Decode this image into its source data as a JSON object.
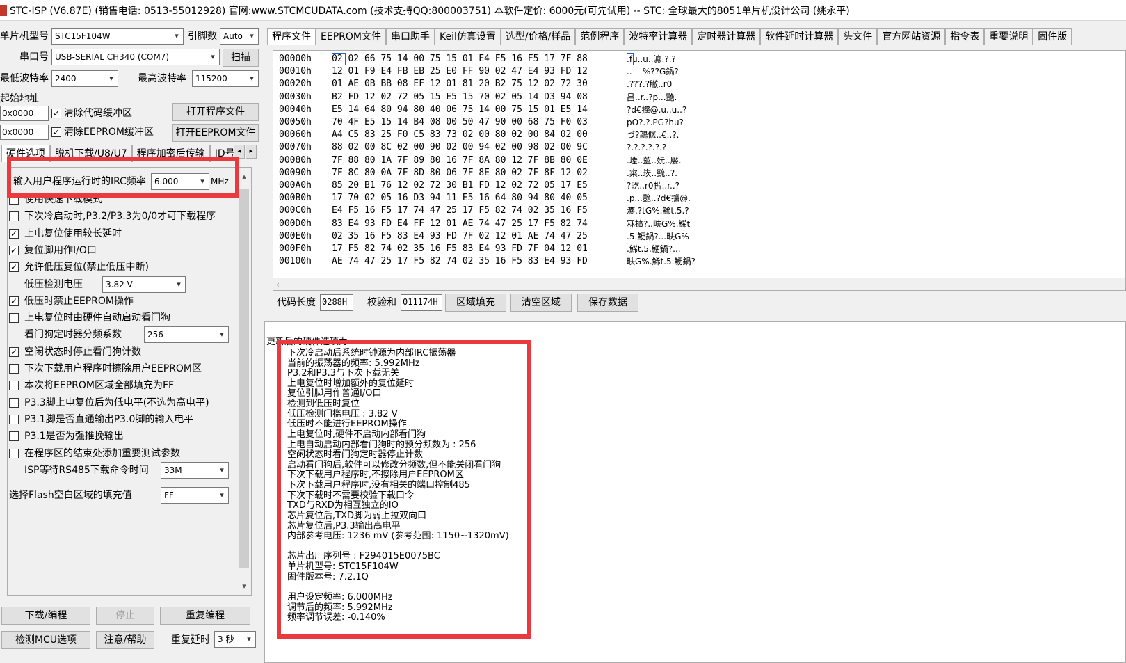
{
  "window": {
    "title": "STC-ISP (V6.87E) (销售电话: 0513-55012928) 官网:www.STCMCUDATA.com  (技术支持QQ:800003751) 本软件定价: 6000元(可先试用) -- STC: 全球最大的8051单片机设计公司 (姚永平)"
  },
  "left": {
    "mcu_model_label": "单片机型号",
    "mcu_model_value": "STC15F104W",
    "pins_label": "引脚数",
    "pins_value": "Auto",
    "port_label": "串口号",
    "port_value": "USB-SERIAL CH340 (COM7)",
    "scan_label": "扫描",
    "min_baud_label": "最低波特率",
    "min_baud_value": "2400",
    "max_baud_label": "最高波特率",
    "max_baud_value": "115200",
    "start_addr_label": "起始地址",
    "addr1_value": "0x0000",
    "clear_code_label": "清除代码缓冲区",
    "open_prog_label": "打开程序文件",
    "addr2_value": "0x0000",
    "clear_eeprom_label": "清除EEPROM缓冲区",
    "open_eeprom_label": "打开EEPROM文件",
    "tabs": [
      "硬件选项",
      "脱机下载/U8/U7",
      "程序加密后传输",
      "ID号"
    ],
    "irc_label": "输入用户程序运行时的IRC频率",
    "irc_value": "6.000",
    "irc_unit": "MHz",
    "options": [
      {
        "label": "使用快速下载模式",
        "checked": false
      },
      {
        "label": "下次冷启动时,P3.2/P3.3为0/0才可下载程序",
        "checked": false
      },
      {
        "label": "上电复位使用较长延时",
        "checked": true
      },
      {
        "label": "复位脚用作I/O口",
        "checked": true
      },
      {
        "label": "允许低压复位(禁止低压中断)",
        "checked": true
      }
    ],
    "low_volt_label": "低压检测电压",
    "low_volt_value": "3.82 V",
    "options2": [
      {
        "label": "低压时禁止EEPROM操作",
        "checked": true
      },
      {
        "label": "上电复位时由硬件自动启动看门狗",
        "checked": false
      }
    ],
    "wdt_label": "看门狗定时器分频系数",
    "wdt_value": "256",
    "options3": [
      {
        "label": "空闲状态时停止看门狗计数",
        "checked": true
      },
      {
        "label": "下次下载用户程序时擦除用户EEPROM区",
        "checked": false
      },
      {
        "label": "本次将EEPROM区域全部填充为FF",
        "checked": false
      },
      {
        "label": "P3.3脚上电复位后为低电平(不选为高电平)",
        "checked": false
      },
      {
        "label": "P3.1脚是否直通输出P3.0脚的输入电平",
        "checked": false
      },
      {
        "label": "P3.1是否为强推挽输出",
        "checked": false
      },
      {
        "label": "在程序区的结束处添加重要测试参数",
        "checked": false
      }
    ],
    "isp_wait_label": "ISP等待RS485下载命令时间",
    "isp_wait_value": "33M",
    "flash_fill_label": "选择Flash空白区域的填充值",
    "flash_fill_value": "FF",
    "download_label": "下载/编程",
    "stop_label": "停止",
    "reprogram_label": "重复编程",
    "detect_label": "检测MCU选项",
    "help_label": "注意/帮助",
    "retry_delay_label": "重复延时",
    "retry_delay_value": "3 秒"
  },
  "right": {
    "tabs": [
      "程序文件",
      "EEPROM文件",
      "串口助手",
      "Keil仿真设置",
      "选型/价格/样品",
      "范例程序",
      "波特率计算器",
      "定时器计算器",
      "软件延时计算器",
      "头文件",
      "官方网站资源",
      "指令表",
      "重要说明",
      "固件版"
    ],
    "hex_rows": [
      {
        "addr": "00000h",
        "bytes": "02 02 66 75 14 00 75 15 01 E4 F5 16 F5 17 7F 88",
        "ascii": ".fu..u..瀌.?.?"
      },
      {
        "addr": "00010h",
        "bytes": "12 01 F9 E4 FB EB 25 E0 FF 90 02 47 E4 93 FD 12",
        "ascii": "..    %??G鍋?"
      },
      {
        "addr": "00020h",
        "bytes": "01 AE 0B BB 08 EF 12 01 81 20 B2 75 12 02 72 30",
        "ascii": ".???.?瞮..r0"
      },
      {
        "addr": "00030h",
        "bytes": "B2 FD 12 02 72 05 15 E5 15 70 02 05 14 D3 94 08",
        "ascii": "昌..r..?p...艷."
      },
      {
        "addr": "00040h",
        "bytes": "E5 14 64 80 94 80 40 06 75 14 00 75 15 01 E5 14",
        "ascii": "?d€攩@.u..u..?"
      },
      {
        "addr": "00050h",
        "bytes": "70 4F E5 15 14 B4 08 00 50 47 90 00 68 75 F0 03",
        "ascii": "pO?.?.PG?hu?"
      },
      {
        "addr": "00060h",
        "bytes": "A4 C5 83 25 F0 C5 83 73 02 00 80 02 00 84 02 00",
        "ascii": "づ?鶕僝..€..?."
      },
      {
        "addr": "00070h",
        "bytes": "88 02 00 8C 02 00 90 02 00 94 02 00 98 02 00 9C",
        "ascii": "?.?.?.?.?.?"
      },
      {
        "addr": "00080h",
        "bytes": "7F 88 80 1A 7F 89 80 16 7F 8A 80 12 7F 8B 80 0E",
        "ascii": ".堘..藍..妧..嬮."
      },
      {
        "addr": "00090h",
        "bytes": "7F 8C 80 0A 7F 8D 80 06 7F 8E 80 02 7F 8F 12 02",
        "ascii": ".寀..崁..巰..?."
      },
      {
        "addr": "000A0h",
        "bytes": "85 20 B1 76 12 02 72 30 B1 FD 12 02 72 05 17 E5",
        "ascii": "?盵..r0扸..r..?"
      },
      {
        "addr": "000B0h",
        "bytes": "17 70 02 05 16 D3 94 11 E5 16 64 80 94 80 40 05",
        "ascii": ".p...艷..?d€攩@."
      },
      {
        "addr": "000C0h",
        "bytes": "E4 F5 16 F5 17 74 47 25 17 F5 82 74 02 35 16 F5",
        "ascii": "瀌.?tG%.鯑t.5.?"
      },
      {
        "addr": "000D0h",
        "bytes": "83 E4 93 FD E4 FF 12 01 AE 74 47 25 17 F5 82 74",
        "ascii": "冧擴?..畉G%.鯑t"
      },
      {
        "addr": "000E0h",
        "bytes": "02 35 16 F5 83 E4 93 FD 7F 02 12 01 AE 74 47 25",
        "ascii": ".5.鯁鍋?...畉G%"
      },
      {
        "addr": "000F0h",
        "bytes": "17 F5 82 74 02 35 16 F5 83 E4 93 FD 7F 04 12 01",
        "ascii": ".鯑t.5.鯁鍋?..."
      },
      {
        "addr": "00100h",
        "bytes": "AE 74 47 25 17 F5 82 74 02 35 16 F5 83 E4 93 FD",
        "ascii": "畉G%.鯑t.5.鯁鍋?"
      }
    ],
    "code_len_label": "代码长度",
    "code_len_value": "0288H",
    "checksum_label": "校验和",
    "checksum_value": "011174H",
    "fill_label": "区域填充",
    "clear_label": "清空区域",
    "save_label": "保存数据",
    "output_header": "更新后的硬件选项为:",
    "output_lines": [
      "下次冷启动后系统时钟源为内部IRC振荡器",
      "当前的振荡器的频率: 5.992MHz",
      "P3.2和P3.3与下次下载无关",
      "上电复位时增加额外的复位延时",
      "复位引脚用作普通I/O口",
      "检测到低压时复位",
      "低压检测门槛电压 : 3.82 V",
      "低压时不能进行EEPROM操作",
      "上电复位时,硬件不启动内部看门狗",
      "上电自动启动内部看门狗时的预分频数为 : 256",
      "空闲状态时看门狗定时器停止计数",
      "启动看门狗后,软件可以修改分频数,但不能关闭看门狗",
      "下次下载用户程序时,不擦除用户EEPROM区",
      "下次下载用户程序时,没有相关的端口控制485",
      "下次下载时不需要校验下载口令",
      "TXD与RXD为相互独立的IO",
      "芯片复位后,TXD脚为弱上拉双向口",
      "芯片复位后,P3.3输出高电平",
      "内部参考电压: 1236 mV (参考范围: 1150~1320mV)",
      "",
      "芯片出厂序列号 : F294015E0075BC",
      "单片机型号: STC15F104W",
      "固件版本号: 7.2.1Q",
      "",
      "用户设定频率: 6.000MHz",
      "调节后的频率: 5.992MHz",
      "频率调节误差: -0.140%"
    ]
  },
  "colors": {
    "highlight": "#ea3a3d"
  }
}
